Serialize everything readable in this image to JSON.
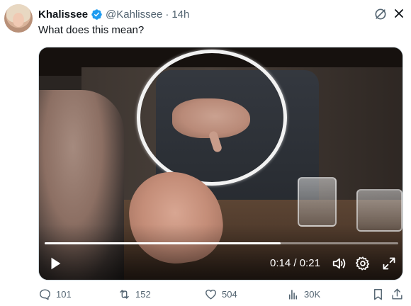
{
  "tweet": {
    "author_name": "Khalissee",
    "handle": "@Kahlissee",
    "separator": "·",
    "time": "14h",
    "text": "What does this mean?"
  },
  "video": {
    "current_time": "0:14",
    "time_separator": " / ",
    "duration": "0:21",
    "progress_fraction": 0.667
  },
  "actions": {
    "replies": "101",
    "reposts": "152",
    "likes": "504",
    "views": "30K"
  },
  "colors": {
    "verified": "#1d9bf0",
    "secondary_text": "#536471",
    "primary_text": "#0f1419"
  },
  "icons": {
    "verified": "verified-badge-icon",
    "grok": "grok-icon",
    "close": "close-icon",
    "play": "play-icon",
    "volume": "volume-icon",
    "settings": "gear-icon",
    "fullscreen": "fullscreen-icon",
    "reply": "reply-icon",
    "repost": "repost-icon",
    "like": "heart-icon",
    "views": "views-icon",
    "bookmark": "bookmark-icon",
    "share": "share-icon"
  }
}
